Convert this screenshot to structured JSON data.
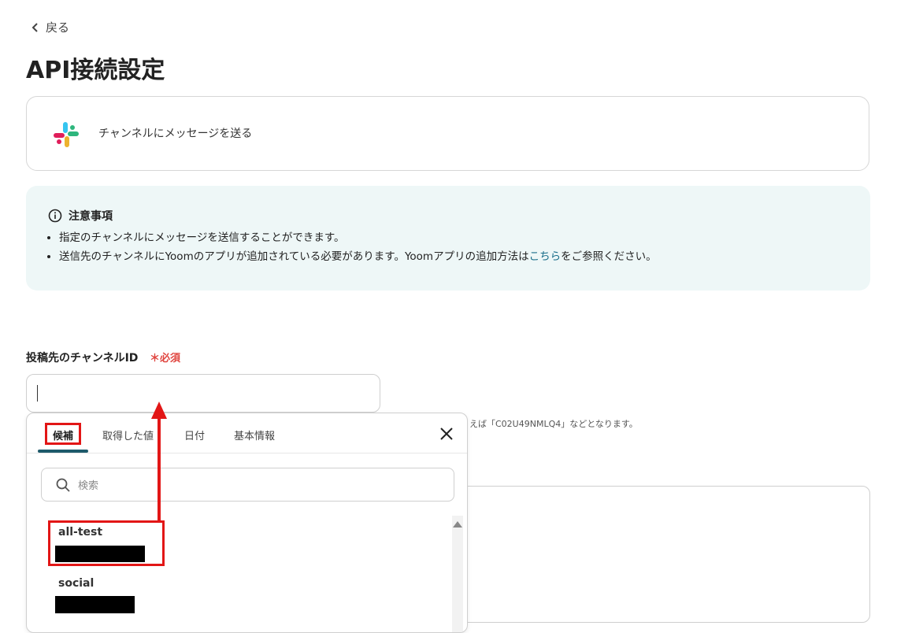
{
  "nav": {
    "back_label": "戻る"
  },
  "page": {
    "title": "API接続設定"
  },
  "app_card": {
    "icon": "slack-logo",
    "action_label": "チャンネルにメッセージを送る"
  },
  "notice": {
    "heading": "注意事項",
    "items": [
      "指定のチャンネルにメッセージを送信することができます。",
      {
        "before": "送信先のチャンネルにYoomのアプリが追加されている必要があります。Yoomアプリの追加方法は",
        "link": "こちら",
        "after": "をご参照ください。"
      }
    ]
  },
  "field": {
    "label": "投稿先のチャンネルID",
    "required_label": "必須",
    "value": "",
    "hint": "えば「C02U49NMLQ4」などとなります。"
  },
  "dropdown": {
    "tabs": [
      {
        "label": "候補",
        "active": true
      },
      {
        "label": "取得した値",
        "active": false
      },
      {
        "label": "日付",
        "active": false
      },
      {
        "label": "基本情報",
        "active": false
      }
    ],
    "search_placeholder": "検索",
    "options": [
      {
        "name": "all-test",
        "id_redacted": true
      },
      {
        "name": "social",
        "id_redacted": true
      }
    ]
  },
  "colors": {
    "accent": "#1e5a6b",
    "required": "#e0453f",
    "annotation": "#e21616",
    "notice_bg": "#eef7f7",
    "link": "#1a6e8a"
  }
}
